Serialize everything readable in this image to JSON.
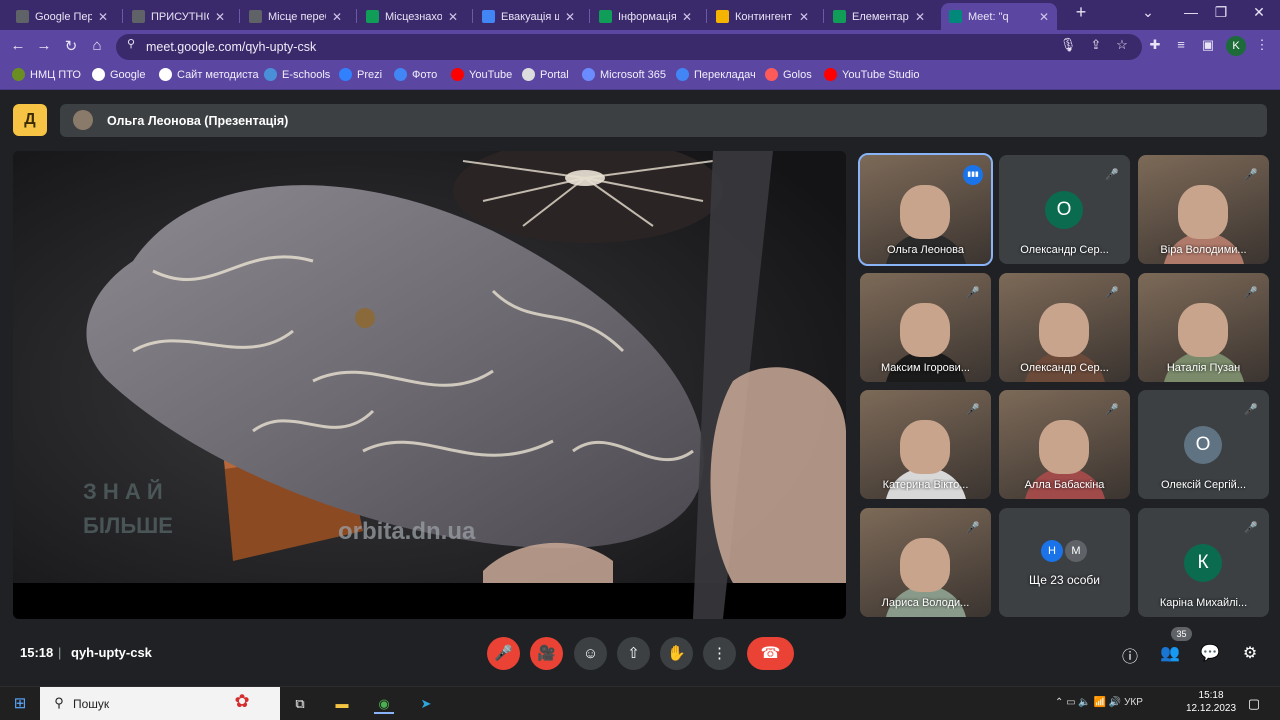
{
  "browser": {
    "tabs": [
      {
        "title": "Google Пере",
        "favicon": "google-translate-icon",
        "color": "#5f6368"
      },
      {
        "title": "ПРИСУТНІСТ",
        "favicon": "form-icon",
        "color": "#5f6368"
      },
      {
        "title": "Місце переб",
        "favicon": "form-icon",
        "color": "#5f6368"
      },
      {
        "title": "Місцезнаход",
        "favicon": "sheets-icon",
        "color": "#0f9d58"
      },
      {
        "title": "Евакуація що",
        "favicon": "docs-icon",
        "color": "#4285f4"
      },
      {
        "title": "Інформація",
        "favicon": "sheets-icon",
        "color": "#0f9d58"
      },
      {
        "title": "Контингент",
        "favicon": "drive-icon",
        "color": "#f4b400"
      },
      {
        "title": "Елементарн",
        "favicon": "th-icon",
        "color": "#0f9d58"
      },
      {
        "title": "Meet: \"q",
        "favicon": "meet-icon",
        "color": "#00897b",
        "active": true
      }
    ],
    "url": "meet.google.com/qyh-upty-csk",
    "profile_initial": "K",
    "bookmarks": [
      {
        "label": "НМЦ ПТО",
        "icon": "nmc-icon",
        "color": "#6b8e23"
      },
      {
        "label": "Google",
        "icon": "google-icon",
        "color": "#ffffff"
      },
      {
        "label": "Сайт методиста",
        "icon": "site-icon",
        "color": "#ffffff"
      },
      {
        "label": "E-schools",
        "icon": "eschools-icon",
        "color": "#4a90d9"
      },
      {
        "label": "Prezi",
        "icon": "prezi-icon",
        "color": "#3181ff"
      },
      {
        "label": "Фото",
        "icon": "photos-icon",
        "color": "#4285f4"
      },
      {
        "label": "YouTube",
        "icon": "youtube-icon",
        "color": "#ff0000"
      },
      {
        "label": "Portal",
        "icon": "globe-icon",
        "color": "#dddddd"
      },
      {
        "label": "Microsoft 365",
        "icon": "microsoft365-icon",
        "color": "#6b8cff"
      },
      {
        "label": "Перекладач",
        "icon": "translate-icon",
        "color": "#4285f4"
      },
      {
        "label": "Golos",
        "icon": "golos-icon",
        "color": "#ff5a5a"
      },
      {
        "label": "YouTube Studio",
        "icon": "youtube-studio-icon",
        "color": "#ff0000"
      }
    ]
  },
  "meet": {
    "logo_letter": "Д",
    "presenter_title": "Ольга Леонова (Презентація)",
    "video_watermark": "orbita.dn.ua",
    "video_overlay_text": "ЗНАЙ БІЛЬШЕ",
    "participants": [
      {
        "name": "Ольга Леонова",
        "type": "photo",
        "speaking": true,
        "shirt": "#2a2a2a"
      },
      {
        "name": "Олександр Сер...",
        "type": "avatar",
        "initial": "О",
        "color": "#0b6b4e"
      },
      {
        "name": "Віра Володими...",
        "type": "photo",
        "shirt": "#b07a6a"
      },
      {
        "name": "Максим Ігорови...",
        "type": "photo",
        "shirt": "#1a1a1a"
      },
      {
        "name": "Олександр Сер...",
        "type": "photo",
        "shirt": "#6b4a3a"
      },
      {
        "name": "Наталія Пузан",
        "type": "photo",
        "shirt": "#7a8a6a"
      },
      {
        "name": "Катерина Вікто...",
        "type": "photo",
        "shirt": "#d8d8d8"
      },
      {
        "name": "Алла Бабаскіна",
        "type": "photo",
        "shirt": "#a04a4a"
      },
      {
        "name": "Олексій Сергій...",
        "type": "avatar",
        "initial": "О",
        "color": "#5f7382"
      },
      {
        "name": "Лариса Володи...",
        "type": "photo",
        "shirt": "#8a9a8a"
      },
      {
        "name": "Ще 23 особи",
        "type": "more",
        "initials": [
          "Н",
          "М"
        ],
        "colors": [
          "#1a73e8",
          "#5f6368"
        ]
      },
      {
        "name": "Каріна Михайлі...",
        "type": "avatar",
        "initial": "К",
        "color": "#0b6b4e"
      }
    ],
    "time": "15:18",
    "meeting_code": "qyh-upty-csk",
    "participants_count": "35",
    "accent_red": "#ea4335"
  },
  "taskbar": {
    "search_placeholder": "Пошук",
    "language": "УКР",
    "time": "15:18",
    "date": "12.12.2023"
  }
}
